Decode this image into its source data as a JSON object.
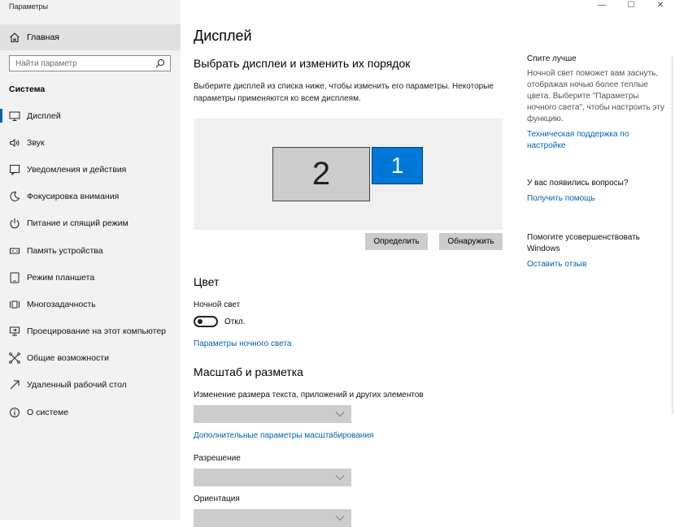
{
  "window": {
    "title": "Параметры",
    "controls": {
      "minimize": "—",
      "maximize": "☐",
      "close": "✕"
    }
  },
  "sidebar": {
    "home_label": "Главная",
    "search_placeholder": "Найти параметр",
    "section_heading": "Система",
    "items": [
      {
        "label": "Дисплей",
        "icon": "monitor-icon",
        "selected": true
      },
      {
        "label": "Звук",
        "icon": "speaker-icon"
      },
      {
        "label": "Уведомления и действия",
        "icon": "notification-icon"
      },
      {
        "label": "Фокусировка внимания",
        "icon": "moon-icon"
      },
      {
        "label": "Питание и спящий режим",
        "icon": "power-icon"
      },
      {
        "label": "Память устройства",
        "icon": "storage-icon"
      },
      {
        "label": "Режим планшета",
        "icon": "tablet-icon"
      },
      {
        "label": "Многозадачность",
        "icon": "multitasking-icon"
      },
      {
        "label": "Проецирование на этот компьютер",
        "icon": "projecting-icon"
      },
      {
        "label": "Общие возможности",
        "icon": "shared-experiences-icon"
      },
      {
        "label": "Удаленный рабочий стол",
        "icon": "remote-desktop-icon"
      },
      {
        "label": "О системе",
        "icon": "info-icon"
      }
    ]
  },
  "main": {
    "title": "Дисплей",
    "arrange": {
      "heading": "Выбрать дисплеи и изменить их порядок",
      "description": "Выберите дисплей из списка ниже, чтобы изменить его параметры. Некоторые параметры применяются ко всем дисплеям.",
      "monitor_secondary": "2",
      "monitor_primary": "1",
      "identify_label": "Определить",
      "detect_label": "Обнаружить"
    },
    "color": {
      "heading": "Цвет",
      "night_light_label": "Ночной свет",
      "night_light_state": "Откл.",
      "night_light_on": false,
      "night_light_settings_link": "Параметры ночного света"
    },
    "scale": {
      "heading": "Масштаб и разметка",
      "text_size_label": "Изменение размера текста, приложений и других элементов",
      "text_size_value": "",
      "advanced_link": "Дополнительные параметры масштабирования",
      "resolution_label": "Разрешение",
      "resolution_value": "",
      "orientation_label": "Ориентация",
      "orientation_value": ""
    }
  },
  "right_panel": {
    "sleep": {
      "heading": "Спите лучше",
      "text": "Ночной свет поможет вам заснуть, отображая ночью более теплые цвета. Выберите \"Параметры ночного света\", чтобы настроить эту функцию.",
      "link": "Техническая поддержка по настройке"
    },
    "questions": {
      "heading": "У вас появились вопросы?",
      "link": "Получить помощь"
    },
    "improve": {
      "heading": "Помогите усовершенствовать Windows",
      "link": "Оставить отзыв"
    }
  },
  "colors": {
    "accent": "#0078d7",
    "link": "#0063b1",
    "sidebar_bg": "#f2f2f2",
    "button_bg": "#cccccc"
  }
}
